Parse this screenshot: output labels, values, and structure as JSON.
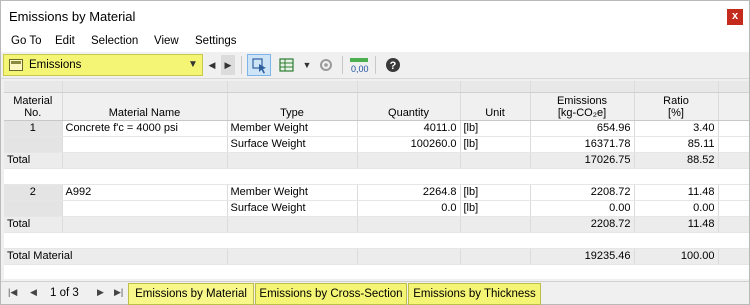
{
  "window": {
    "title": "Emissions by Material",
    "close_glyph": "x"
  },
  "menu": [
    "Go To",
    "Edit",
    "Selection",
    "View",
    "Settings"
  ],
  "toolbar": {
    "selected": "Emissions"
  },
  "headers": {
    "c1": [
      "Material",
      "No."
    ],
    "c2": [
      "Material Name"
    ],
    "c3": [
      "Type"
    ],
    "c4": [
      "Quantity"
    ],
    "c5": [
      "Unit"
    ],
    "c6": [
      "Emissions",
      "[kg-CO₂e]"
    ],
    "c7": [
      "Ratio",
      "[%]"
    ]
  },
  "rows": [
    {
      "no": "1",
      "name": "Concrete f'c = 4000 psi",
      "type": "Member Weight",
      "qty": "4011.0",
      "unit": "[lb]",
      "emis": "654.96",
      "ratio": "3.40"
    },
    {
      "no": "",
      "name": "",
      "type": "Surface Weight",
      "qty": "100260.0",
      "unit": "[lb]",
      "emis": "16371.78",
      "ratio": "85.11"
    },
    {
      "no": "Total",
      "name": "",
      "type": "",
      "qty": "",
      "unit": "",
      "emis": "17026.75",
      "ratio": "88.52"
    },
    {
      "no": "2",
      "name": "A992",
      "type": "Member Weight",
      "qty": "2264.8",
      "unit": "[lb]",
      "emis": "2208.72",
      "ratio": "11.48"
    },
    {
      "no": "",
      "name": "",
      "type": "Surface Weight",
      "qty": "0.0",
      "unit": "[lb]",
      "emis": "0.00",
      "ratio": "0.00"
    },
    {
      "no": "Total",
      "name": "",
      "type": "",
      "qty": "",
      "unit": "",
      "emis": "2208.72",
      "ratio": "11.48"
    },
    {
      "no": "Total Material",
      "name": "",
      "type": "",
      "qty": "",
      "unit": "",
      "emis": "19235.46",
      "ratio": "100.00"
    }
  ],
  "status": {
    "page_text": "1 of 3",
    "tabs": [
      "Emissions by Material",
      "Emissions by Cross-Section",
      "Emissions by Thickness"
    ]
  },
  "colors": {
    "highlight": "#f5f575",
    "active_button": "#cde4f7"
  }
}
